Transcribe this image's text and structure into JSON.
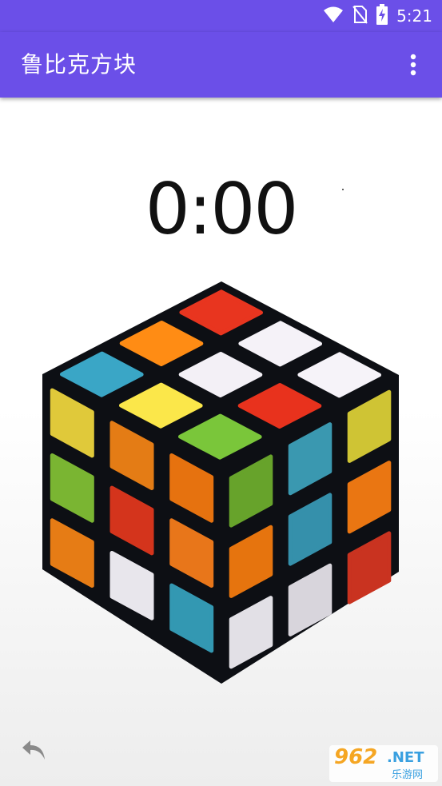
{
  "status_bar": {
    "time": "5:21"
  },
  "app_bar": {
    "title": "鲁比克方块"
  },
  "timer": {
    "value": "0:00"
  },
  "watermark": {
    "brand": "962",
    "net": ".NET",
    "sub": "乐游网"
  },
  "cube": {
    "top": [
      "#e8351f",
      "#f5f2f8",
      "#f6f3f9",
      "#ff8c14",
      "#f3f0f6",
      "#e8321d",
      "#3aa6c6",
      "#fbe74a",
      "#7ac63a"
    ],
    "left": [
      "#e0c93a",
      "#e47c15",
      "#e6720f",
      "#7ab532",
      "#d4341c",
      "#e8761a",
      "#e67c15",
      "#e8e6ec",
      "#3398b2"
    ],
    "right": [
      "#67a32b",
      "#3a98b0",
      "#cfc434",
      "#e6740e",
      "#3590ab",
      "#ea7612",
      "#e2e0e6",
      "#d8d5dc",
      "#c93320"
    ]
  }
}
